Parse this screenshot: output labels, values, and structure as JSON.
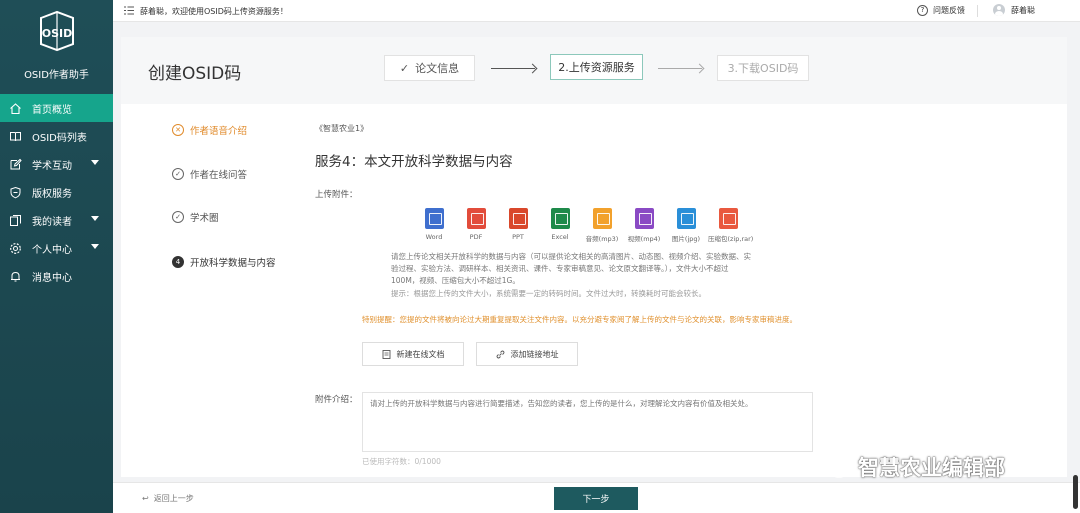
{
  "sidebar": {
    "logo_text": "OSID",
    "app_name": "OSID作者助手",
    "items": [
      {
        "label": "首页概览",
        "icon": "home-icon",
        "active": true,
        "has_arrow": false
      },
      {
        "label": "OSID码列表",
        "icon": "book-icon",
        "active": false,
        "has_arrow": false
      },
      {
        "label": "学术互动",
        "icon": "edit-icon",
        "active": false,
        "has_arrow": true
      },
      {
        "label": "版权服务",
        "icon": "shield-icon",
        "active": false,
        "has_arrow": false
      },
      {
        "label": "我的读者",
        "icon": "readers-icon",
        "active": false,
        "has_arrow": true
      },
      {
        "label": "个人中心",
        "icon": "gear-icon",
        "active": false,
        "has_arrow": true
      },
      {
        "label": "消息中心",
        "icon": "bell-icon",
        "active": false,
        "has_arrow": false
      }
    ]
  },
  "topbar": {
    "welcome": "薛着聪，欢迎使用OSID码上传资源服务！",
    "feedback": "问题反馈",
    "username": "薛着聪"
  },
  "page": {
    "title": "创建OSID码",
    "steps": [
      {
        "label": "论文信息",
        "status": "done"
      },
      {
        "label": "2.上传资源服务",
        "status": "current"
      },
      {
        "label": "3.下载OSID码",
        "status": "pending"
      }
    ],
    "left_steps": [
      {
        "label": "作者语音介绍",
        "marker": "",
        "state": "warning"
      },
      {
        "label": "作者在线问答",
        "marker": "",
        "state": "done"
      },
      {
        "label": "学术圈",
        "marker": "",
        "state": "done"
      },
      {
        "label": "开放科学数据与内容",
        "marker": "4",
        "state": "current"
      }
    ]
  },
  "main": {
    "journal": "《智慧农业1》",
    "service_title": "服务4：本文开放科学数据与内容",
    "upload_label": "上传附件：",
    "file_types": [
      {
        "label": "Word",
        "icon": "word-icon",
        "color": "#3f6fce"
      },
      {
        "label": "PDF",
        "icon": "pdf-icon",
        "color": "#e24c3b"
      },
      {
        "label": "PPT",
        "icon": "ppt-icon",
        "color": "#d9482b"
      },
      {
        "label": "Excel",
        "icon": "excel-icon",
        "color": "#1e8a4a"
      },
      {
        "label": "音频(mp3)",
        "icon": "audio-icon",
        "color": "#f2a12c"
      },
      {
        "label": "视频(mp4)",
        "icon": "video-icon",
        "color": "#8a4ac4"
      },
      {
        "label": "图片(jpg)",
        "icon": "image-icon",
        "color": "#2a8fd8"
      },
      {
        "label": "压缩包(zip,rar)",
        "icon": "archive-icon",
        "color": "#e9593f"
      }
    ],
    "upload_desc": "请您上传论文相关开放科学的数据与内容（可以提供论文相关的高清图片、动态图、视频介绍、实验数据、实验过程、实验方法、调研样本、相关资讯、课件、专家审稿意见、论文原文翻译等。），文件大小不超过100M，视频、压缩包大小不超过1G。",
    "upload_tip": "提示：根据您上传的文件大小，系统需要一定的转码时间。文件过大时，转换耗时可能会较长。",
    "warning": "特别提醒：您提的文件将被向论过大期重复提取关注文件内容。以充分避专家阅了解上传的文件与论文的关联，影响专家审稿进度。",
    "btn_new_doc": "新建在线文档",
    "btn_add_link": "添加链接地址",
    "intro_label": "附件介绍：",
    "intro_placeholder": "请对上传的开放科学数据与内容进行简要描述，告知您的读者，您上传的是什么，对理解论文内容有价值及相关处。",
    "counter": "已使用字符数：0/1000"
  },
  "footer": {
    "back": "返回上一步",
    "next": "下一步"
  },
  "watermark": "智慧农业编辑部"
}
